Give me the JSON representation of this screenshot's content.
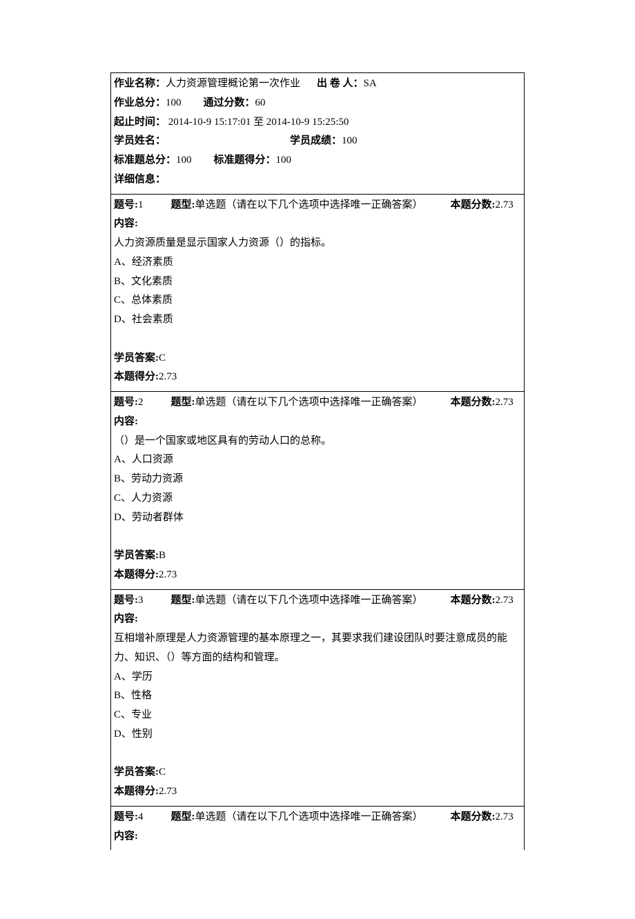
{
  "header": {
    "assignmentNameLabel": "作业名称：",
    "assignmentName": "人力资源管理概论第一次作业",
    "issuerLabel": "出  卷  人：",
    "issuer": "SA",
    "totalScoreLabel": "作业总分：",
    "totalScore": "100",
    "passScoreLabel": "通过分数：",
    "passScore": "60",
    "timeRangeLabel": "起止时间：",
    "timeRange": " 2014-10-9 15:17:01 至 2014-10-9 15:25:50",
    "studentNameLabel": "学员姓名：",
    "studentName": "",
    "studentScoreLabel": "学员成绩：",
    "studentScore": "100",
    "stdTotalLabel": "标准题总分：",
    "stdTotal": "100",
    "stdScoreLabel": "标准题得分：",
    "stdScore": "100",
    "detailsLabel": "详细信息："
  },
  "labels": {
    "qNo": "题号:",
    "qType": "题型:",
    "qTypeText": "单选题（请在以下几个选项中选择唯一正确答案）",
    "qPoints": "本题分数:",
    "content": "内容:",
    "studentAnswer": "学员答案:",
    "earned": "本题得分:"
  },
  "questions": [
    {
      "num": "1",
      "points": "2.73",
      "stem": "人力资源质量是显示国家人力资源（）的指标。",
      "opts": [
        "A、经济素质",
        "B、文化素质",
        "C、总体素质",
        "D、社会素质"
      ],
      "answer": "C",
      "earned": "2.73"
    },
    {
      "num": "2",
      "points": "2.73",
      "stem": "（）是一个国家或地区具有的劳动人口的总称。",
      "opts": [
        "A、人口资源",
        "B、劳动力资源",
        "C、人力资源",
        "D、劳动者群体"
      ],
      "answer": "B",
      "earned": "2.73"
    },
    {
      "num": "3",
      "points": "2.73",
      "stem": "互相增补原理是人力资源管理的基本原理之一，其要求我们建设团队时要注意成员的能力、知识、（）等方面的结构和管理。",
      "opts": [
        "A、学历",
        "B、性格",
        "C、专业",
        "D、性别"
      ],
      "answer": "C",
      "earned": "2.73"
    },
    {
      "num": "4",
      "points": "2.73",
      "stem": "",
      "opts": [],
      "answer": null,
      "earned": null
    }
  ]
}
